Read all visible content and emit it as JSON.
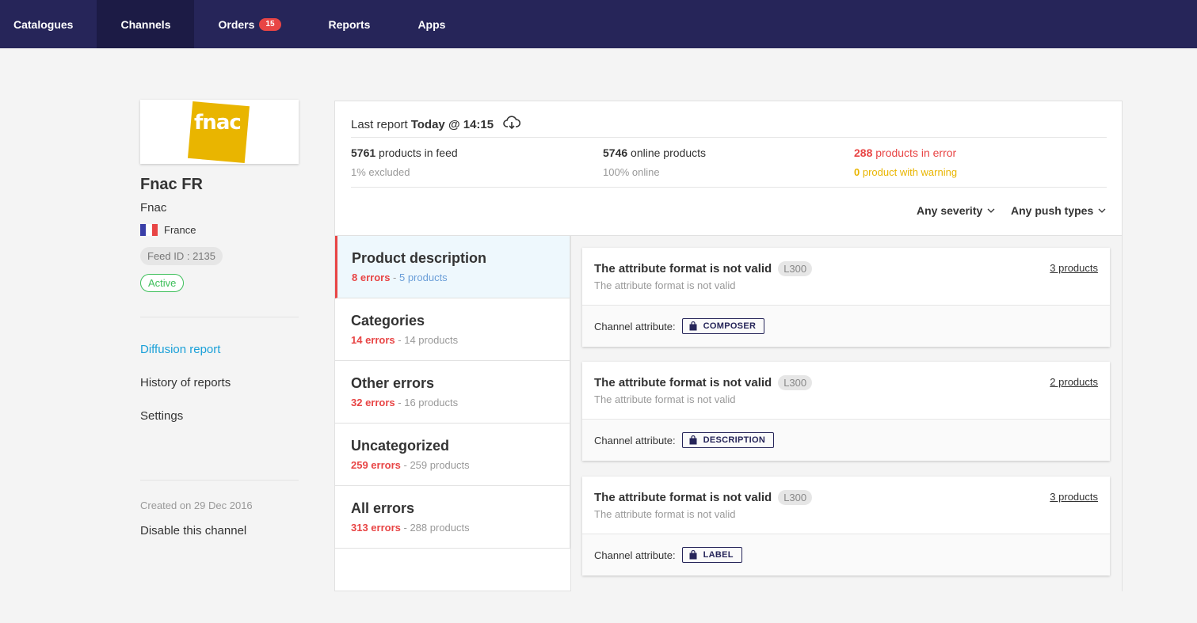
{
  "nav": {
    "items": [
      {
        "label": "Catalogues"
      },
      {
        "label": "Channels"
      },
      {
        "label": "Orders",
        "badge": "15"
      },
      {
        "label": "Reports"
      },
      {
        "label": "Apps"
      }
    ]
  },
  "channel": {
    "logo_text": "fnac",
    "title": "Fnac FR",
    "name": "Fnac",
    "country": "France",
    "feed_id": "Feed ID : 2135",
    "status": "Active",
    "links": [
      "Diffusion report",
      "History of reports",
      "Settings"
    ],
    "created": "Created on 29 Dec 2016",
    "disable": "Disable this channel"
  },
  "report": {
    "label": "Last report",
    "time": "Today @ 14:15",
    "stats": {
      "feed_count": "5761",
      "feed_label": " products in feed",
      "excluded": "1% excluded",
      "online_count": "5746",
      "online_label": " online products",
      "online_pct": "100% online",
      "error_count": "288",
      "error_label": " products in error",
      "warning_count": "0",
      "warning_label": " product with warning"
    },
    "filters": {
      "severity": "Any severity",
      "push_types": "Any push types"
    }
  },
  "categories": [
    {
      "name": "Product description",
      "errors": "8 errors",
      "products": "5 products"
    },
    {
      "name": "Categories",
      "errors": "14 errors",
      "products": "14 products"
    },
    {
      "name": "Other errors",
      "errors": "32 errors",
      "products": "16 products"
    },
    {
      "name": "Uncategorized",
      "errors": "259 errors",
      "products": "259 products"
    },
    {
      "name": "All errors",
      "errors": "313 errors",
      "products": "288 products"
    }
  ],
  "cat_sep": " - ",
  "errors": [
    {
      "title": "The attribute format is not valid",
      "code": "L300",
      "desc": "The attribute format is not valid",
      "products": "3 products",
      "attr_label": "Channel attribute:",
      "attr": "COMPOSER"
    },
    {
      "title": "The attribute format is not valid",
      "code": "L300",
      "desc": "The attribute format is not valid",
      "products": "2 products",
      "attr_label": "Channel attribute:",
      "attr": "DESCRIPTION"
    },
    {
      "title": "The attribute format is not valid",
      "code": "L300",
      "desc": "The attribute format is not valid",
      "products": "3 products",
      "attr_label": "Channel attribute:",
      "attr": "LABEL"
    }
  ],
  "colors": {
    "nav_bg": "#262559",
    "error": "#e84545",
    "warning": "#e9b500",
    "active": "#3dbf5a",
    "link": "#1aa0d8"
  }
}
